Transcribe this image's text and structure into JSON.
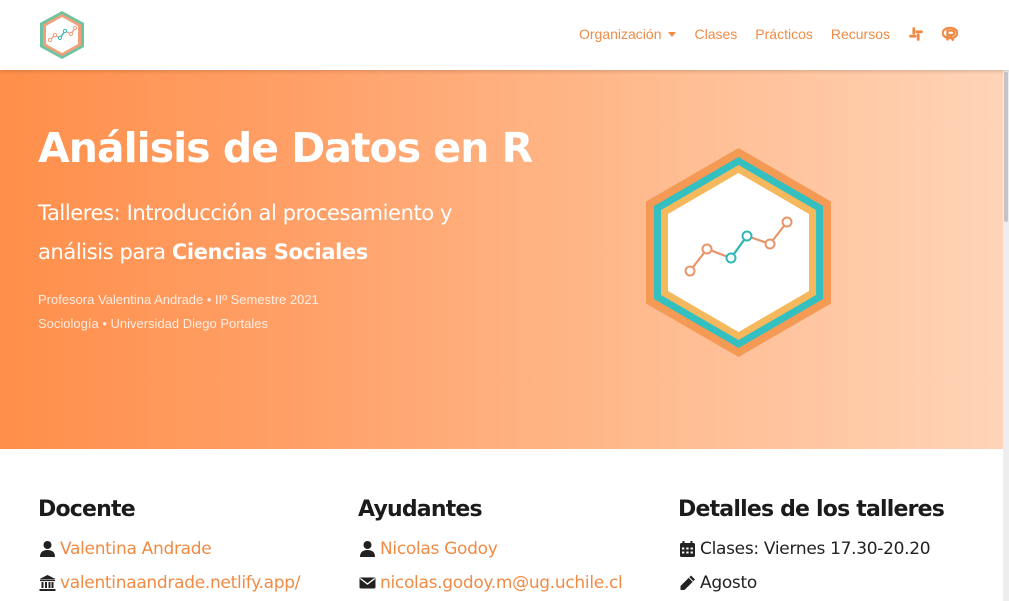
{
  "nav": {
    "items": [
      {
        "label": "Organización",
        "dropdown": true
      },
      {
        "label": "Clases"
      },
      {
        "label": "Prácticos"
      },
      {
        "label": "Recursos"
      }
    ],
    "icons": [
      "slack-icon",
      "r-project-icon"
    ],
    "accent": "#f08b45"
  },
  "hero": {
    "title": "Análisis de Datos en R",
    "subtitle_plain": "Talleres: Introducción al procesamiento y análisis para ",
    "subtitle_bold": "Ciencias Sociales",
    "meta_line1": "Profesora Valentina Andrade • IIº Semestre 2021",
    "meta_line2": "Sociología • Universidad Diego Portales",
    "gradient": [
      "#ff8f4a",
      "#ffd4b8"
    ]
  },
  "docente": {
    "heading": "Docente",
    "name": "Valentina Andrade",
    "website": "valentinaandrade.netlify.app/"
  },
  "ayudantes": {
    "heading": "Ayudantes",
    "name": "Nicolas Godoy",
    "email": "nicolas.godoy.m@ug.uchile.cl"
  },
  "detalles": {
    "heading": "Detalles de los talleres",
    "schedule": "Clases: Viernes 17.30-20.20",
    "month": "Agosto"
  }
}
